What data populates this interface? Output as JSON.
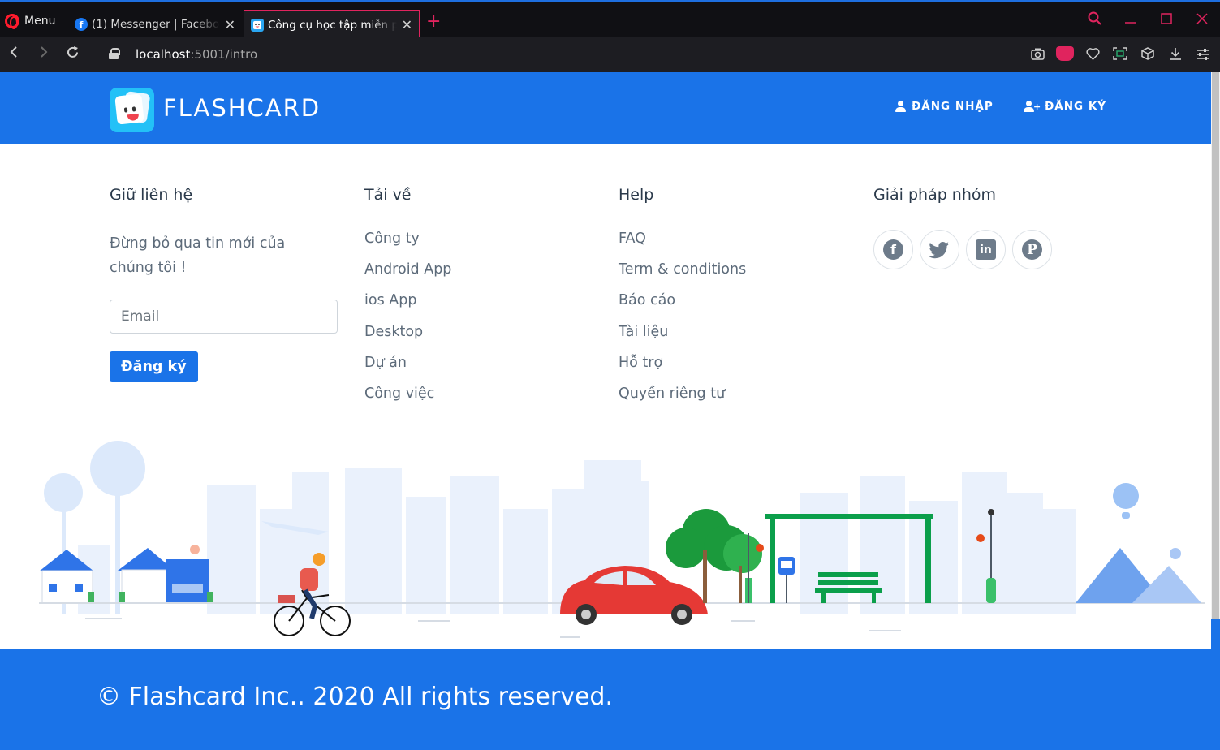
{
  "browser": {
    "menu_label": "Menu",
    "tabs": [
      {
        "title": "(1) Messenger | Facebook"
      },
      {
        "title": "Công cụ học tập miễn phí"
      }
    ],
    "url_host": "localhost",
    "url_rest": ":5001/intro"
  },
  "header": {
    "brand": "FLASHCARD",
    "login_label": "ĐĂNG NHẬP",
    "signup_label": "ĐĂNG KÝ"
  },
  "contact": {
    "title": "Giữ liên hệ",
    "text": "Đừng bỏ qua tin mới của chúng tôi !",
    "email_placeholder": "Email",
    "button_label": "Đăng ký"
  },
  "download": {
    "title": "Tải về",
    "links": [
      "Công ty",
      "Android App",
      "ios App",
      "Desktop",
      "Dự án",
      "Công việc"
    ]
  },
  "help": {
    "title": "Help",
    "links": [
      "FAQ",
      "Term & conditions",
      "Báo cáo",
      "Tài liệu",
      "Hỗ trợ",
      "Quyền riêng tư"
    ]
  },
  "team": {
    "title": "Giải pháp nhóm",
    "socials": [
      "facebook-icon",
      "twitter-icon",
      "linkedin-icon",
      "pinterest-icon"
    ]
  },
  "footer": {
    "copyright": "© Flashcard Inc.. 2020 All rights reserved."
  },
  "colors": {
    "primary": "#1a73e8",
    "text": "#5d6b7a",
    "heading": "#2b3a4b",
    "browser_accent": "#e0245e"
  }
}
